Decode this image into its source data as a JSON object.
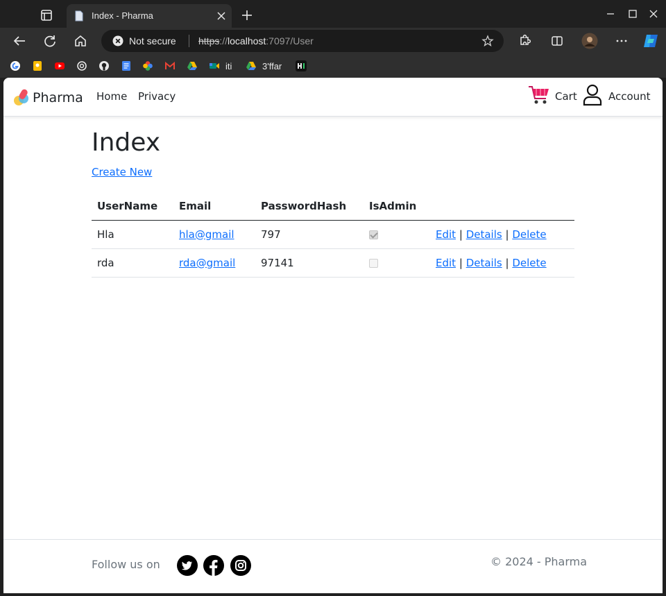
{
  "browser": {
    "tab_title": "Index - Pharma",
    "omnibox": {
      "security_status": "Not secure",
      "url_scheme": "https",
      "url_sep": "://",
      "url_host": "localhost",
      "url_rest": ":7097/User"
    },
    "bookmarks": [
      {
        "label": "",
        "icon": "google-icon",
        "color": "#4285f4"
      },
      {
        "label": "",
        "icon": "keep-icon",
        "color": "#fbbc04"
      },
      {
        "label": "",
        "icon": "youtube-icon",
        "color": "#ff0000"
      },
      {
        "label": "",
        "icon": "openai-icon",
        "color": "#e8e8e8"
      },
      {
        "label": "",
        "icon": "github-icon",
        "color": "#e8e8e8"
      },
      {
        "label": "",
        "icon": "docs-icon",
        "color": "#4285f4"
      },
      {
        "label": "",
        "icon": "photos-icon",
        "color": "#ea4335"
      },
      {
        "label": "",
        "icon": "gmail-icon",
        "color": "#ea4335"
      },
      {
        "label": "",
        "icon": "drive-icon",
        "color": "#34a853"
      },
      {
        "label": "iti",
        "icon": "meet-icon",
        "color": "#00897b"
      },
      {
        "label": "3'ffar",
        "icon": "drive-icon",
        "color": "#fbbc04"
      },
      {
        "label": "",
        "icon": "hackerrank-icon",
        "color": "#111111"
      }
    ]
  },
  "navbar": {
    "brand": "Pharma",
    "links": [
      "Home",
      "Privacy"
    ],
    "cart": "Cart",
    "account": "Account"
  },
  "main": {
    "title": "Index",
    "create_link": "Create New",
    "columns": [
      "UserName",
      "Email",
      "PasswordHash",
      "IsAdmin",
      ""
    ],
    "rows": [
      {
        "username": "Hla",
        "email": "hla@gmail",
        "password_hash": "797",
        "is_admin": true
      },
      {
        "username": "rda",
        "email": "rda@gmail",
        "password_hash": "97141",
        "is_admin": false
      }
    ],
    "actions": {
      "edit": "Edit",
      "details": "Details",
      "delete": "Delete",
      "sep": "|"
    }
  },
  "footer": {
    "follow_label": "Follow us on",
    "social": [
      "twitter-icon",
      "facebook-icon",
      "instagram-icon"
    ],
    "copyright": "© 2024 - Pharma"
  },
  "colors": {
    "link": "#0d6efd",
    "text": "#212529",
    "muted": "#6c757d",
    "chrome_bg": "#202020"
  }
}
